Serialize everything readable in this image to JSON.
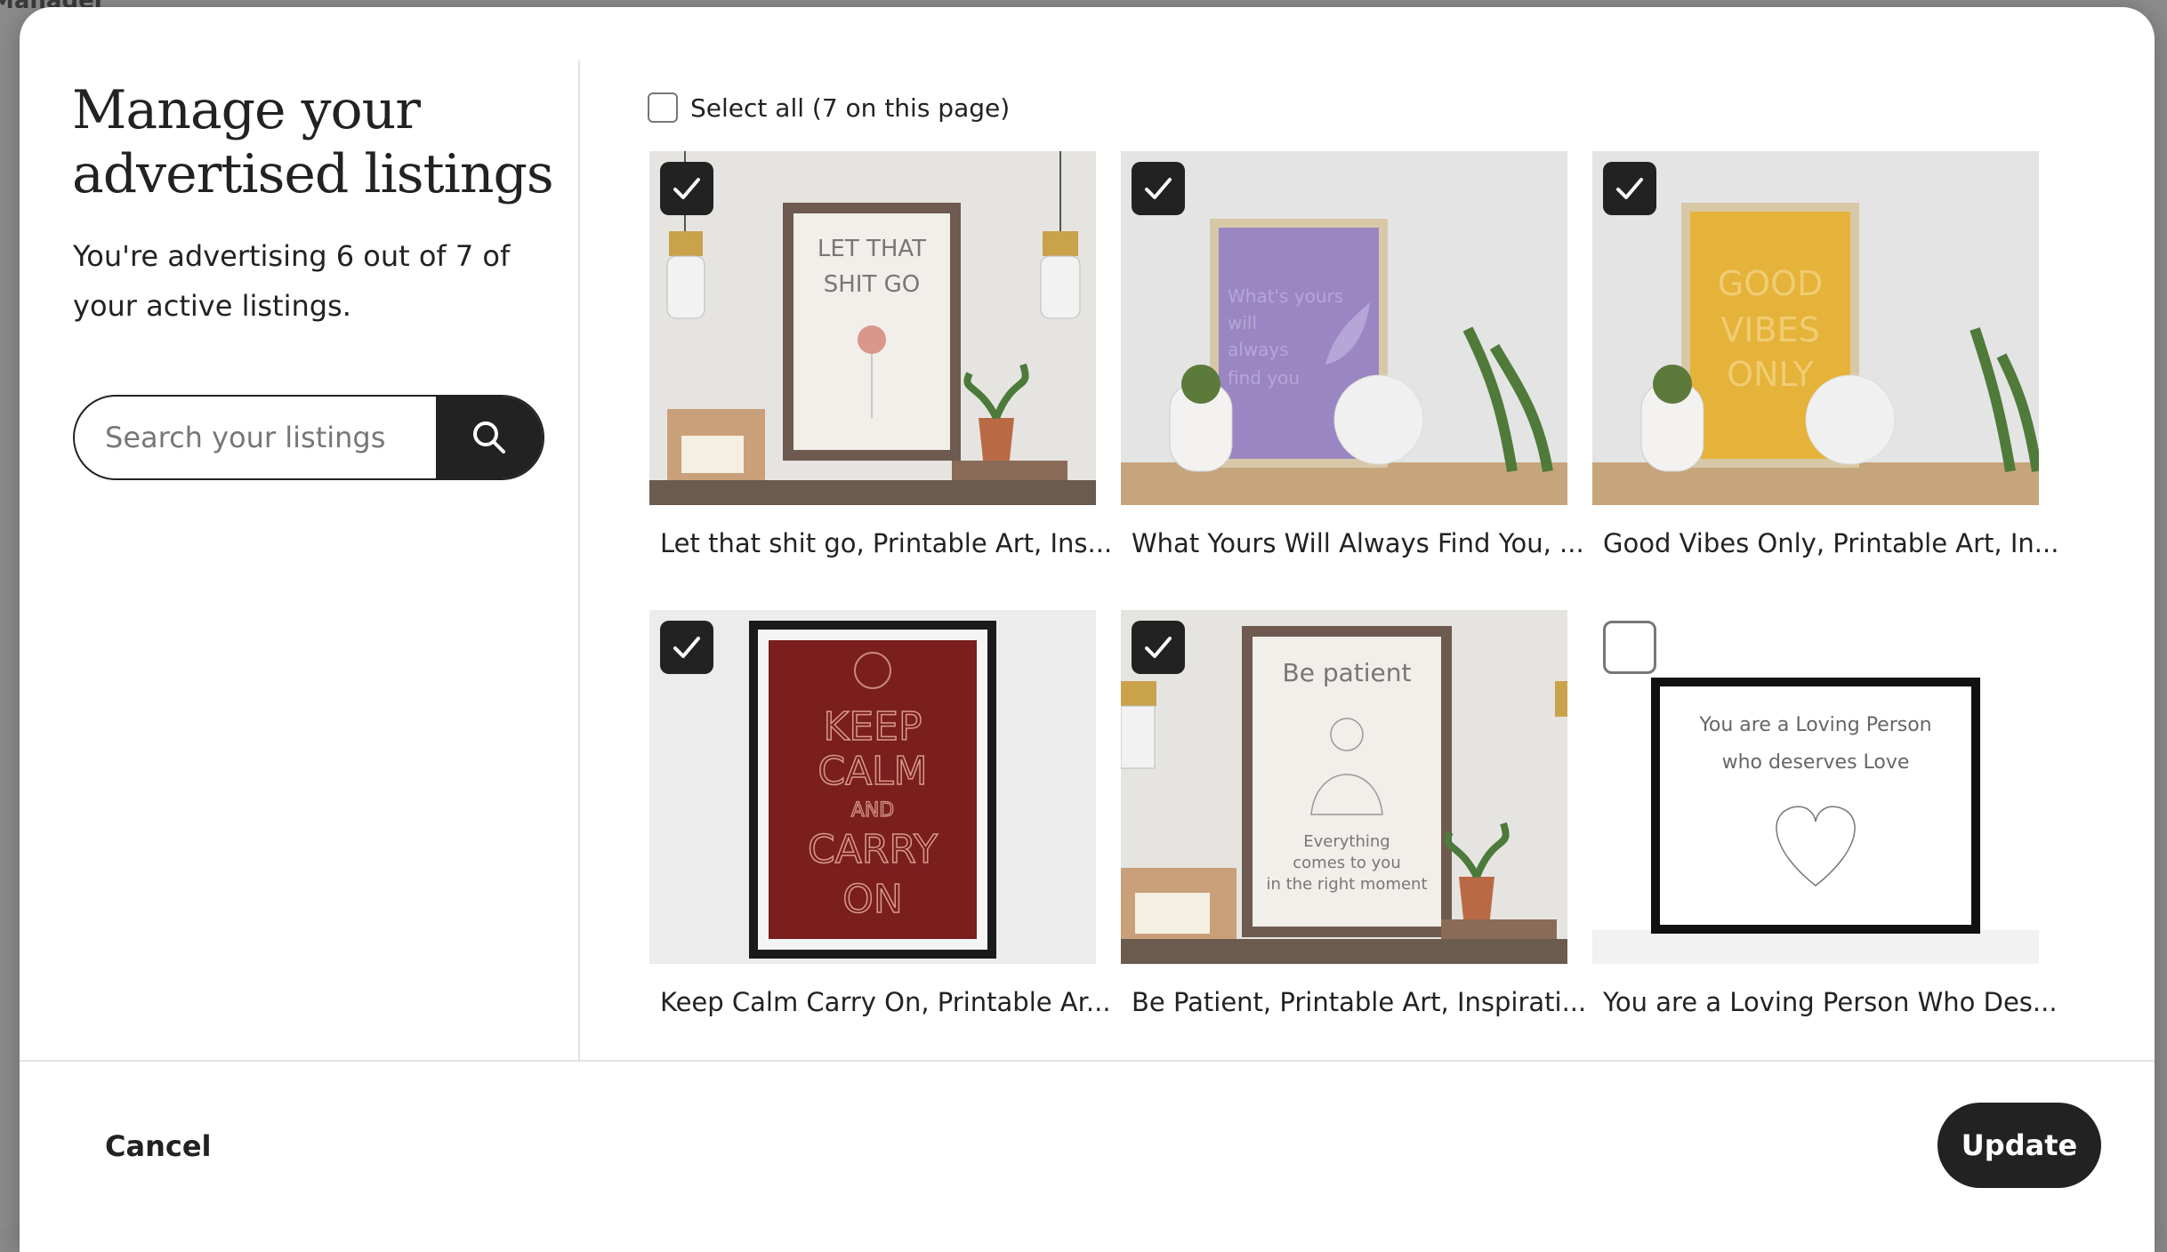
{
  "modal": {
    "title": "Manage your advertised listings",
    "subtitle": "You're advertising 6 out of 7 of your active listings.",
    "search_placeholder": "Search your listings",
    "select_all_label": "Select all (7 on this page)"
  },
  "listings": [
    {
      "title": "Let that shit go, Printable Art, Ins...",
      "checked": true
    },
    {
      "title": "What Yours Will Always Find You, ...",
      "checked": true
    },
    {
      "title": "Good Vibes Only, Printable Art, In...",
      "checked": true
    },
    {
      "title": "Keep Calm Carry On, Printable Ar...",
      "checked": true
    },
    {
      "title": "Be Patient, Printable Art, Inspirati...",
      "checked": true
    },
    {
      "title": "You are a Loving Person Who Des...",
      "checked": false
    }
  ],
  "footer": {
    "cancel_label": "Cancel",
    "update_label": "Update"
  },
  "artwork_text": {
    "a1": "LET THAT",
    "a2": "SHIT GO",
    "b1": "What's yours",
    "b2": "will",
    "b3": "always",
    "b4": "find you",
    "c1": "GOOD",
    "c2": "VIBES",
    "c3": "ONLY",
    "d1": "KEEP",
    "d2": "CALM",
    "d3": "AND",
    "d4": "CARRY",
    "d5": "ON",
    "e1": "Be patient",
    "e2": "Everything",
    "e3": "comes to you",
    "e4": "in the right moment",
    "f1": "You are a Loving Person",
    "f2": "who deserves Love"
  },
  "backdrop": {
    "header_fragment": "Manager"
  },
  "colors": {
    "accent": "#222222",
    "frame_red": "#7a1e1e",
    "frame_purple": "#9a86c2",
    "frame_yellow": "#e5b23a"
  }
}
